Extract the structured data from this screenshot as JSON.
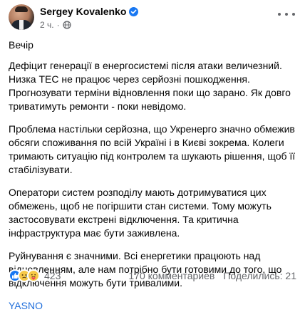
{
  "header": {
    "author": "Sergey Kovalenko",
    "time": "2 ч.",
    "privacy_icon": "globe-icon",
    "verified_icon": "verified-badge-icon",
    "more_icon": "more-options-icon"
  },
  "post": {
    "paragraphs": [
      "Вечір",
      "Дефіцит генерації в енергосистемі після атаки величезний. Низка ТЕС не працює через серйозні пошкодження. Прогнозувати терміни відновлення поки що зарано. Як довго триватимуть ремонти - поки невідомо.",
      "Проблема настільки серйозна, що Укренерго значно обмежив обсяги споживання по всій Україні і в Києві зокрема. Колеги тримають ситуацію під контролем та шукають рішення, щоб її стабілізувати.",
      "Оператори систем розподілу мають дотримуватися цих обмежень, щоб не погіршити стан системи. Тому можуть застосовувати екстрені відключення. Та критична інфраструктура має бути заживлена.",
      "Руйнування є значними. Всі енергетики працюють над відновленням, але нам потрібно бути готовими до того, що відключення можуть бути тривалими."
    ],
    "hashtag": "YASNO"
  },
  "footer": {
    "reaction_count": "423",
    "reactions": [
      "like-icon",
      "sad-icon",
      "care-icon"
    ],
    "comments": "170 комментариев",
    "shares": "Поделились: 21"
  },
  "colors": {
    "text": "#050505",
    "secondary": "#65676b",
    "link": "#216fdb",
    "accent": "#1877f2"
  }
}
